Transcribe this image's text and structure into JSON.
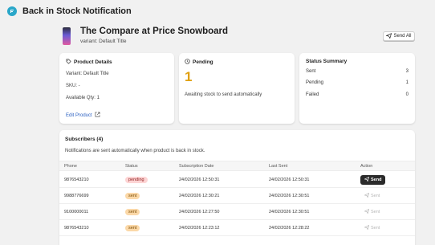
{
  "app": {
    "title": "Back in Stock Notification",
    "icon": "app-logo-icon"
  },
  "product": {
    "title": "The Compare at Price Snowboard",
    "variant_line": "variant: Default Title"
  },
  "header_actions": {
    "send_all_label": "Send All"
  },
  "product_details": {
    "title": "Product Details",
    "variant": "Variant: Default Title",
    "sku": "SKU: -",
    "available_qty": "Available Qty: 1",
    "edit_link": "Edit Product"
  },
  "pending_card": {
    "title": "Pending",
    "count": "1",
    "caption": "Awaiting stock to send automatically",
    "accent": "#e0a00f"
  },
  "status_summary": {
    "title": "Status Summary",
    "rows": [
      {
        "label": "Sent",
        "value": "3"
      },
      {
        "label": "Pending",
        "value": "1"
      },
      {
        "label": "Failed",
        "value": "0"
      }
    ]
  },
  "subscribers": {
    "title": "Subscribers (4)",
    "note": "Notifications are sent automatically when product is back in stock.",
    "columns": {
      "phone": "Phone",
      "status": "Status",
      "subscription_date": "Subscription Date",
      "last_sent": "Last Sent",
      "action": "Action"
    },
    "rows": [
      {
        "phone": "9876543210",
        "status": "pending",
        "subscription_date": "24/02/2026 12:50:31",
        "last_sent": "24/02/2026 12:50:31",
        "action": "Send",
        "action_enabled": true
      },
      {
        "phone": "9988776699",
        "status": "sent",
        "subscription_date": "24/02/2026 12:30:21",
        "last_sent": "24/02/2026 12:30:51",
        "action": "Sent",
        "action_enabled": false
      },
      {
        "phone": "9100000011",
        "status": "sent",
        "subscription_date": "24/02/2026 12:27:50",
        "last_sent": "24/02/2026 12:30:51",
        "action": "Sent",
        "action_enabled": false
      },
      {
        "phone": "9876543210",
        "status": "sent",
        "subscription_date": "24/02/2026 12:23:12",
        "last_sent": "24/02/2026 12:28:22",
        "action": "Sent",
        "action_enabled": false
      }
    ]
  },
  "colors": {
    "pending_badge": "#fdd4d4",
    "sent_badge": "#fbd8a8",
    "link": "#2a5fc1",
    "primary_button": "#2b2b2b"
  }
}
